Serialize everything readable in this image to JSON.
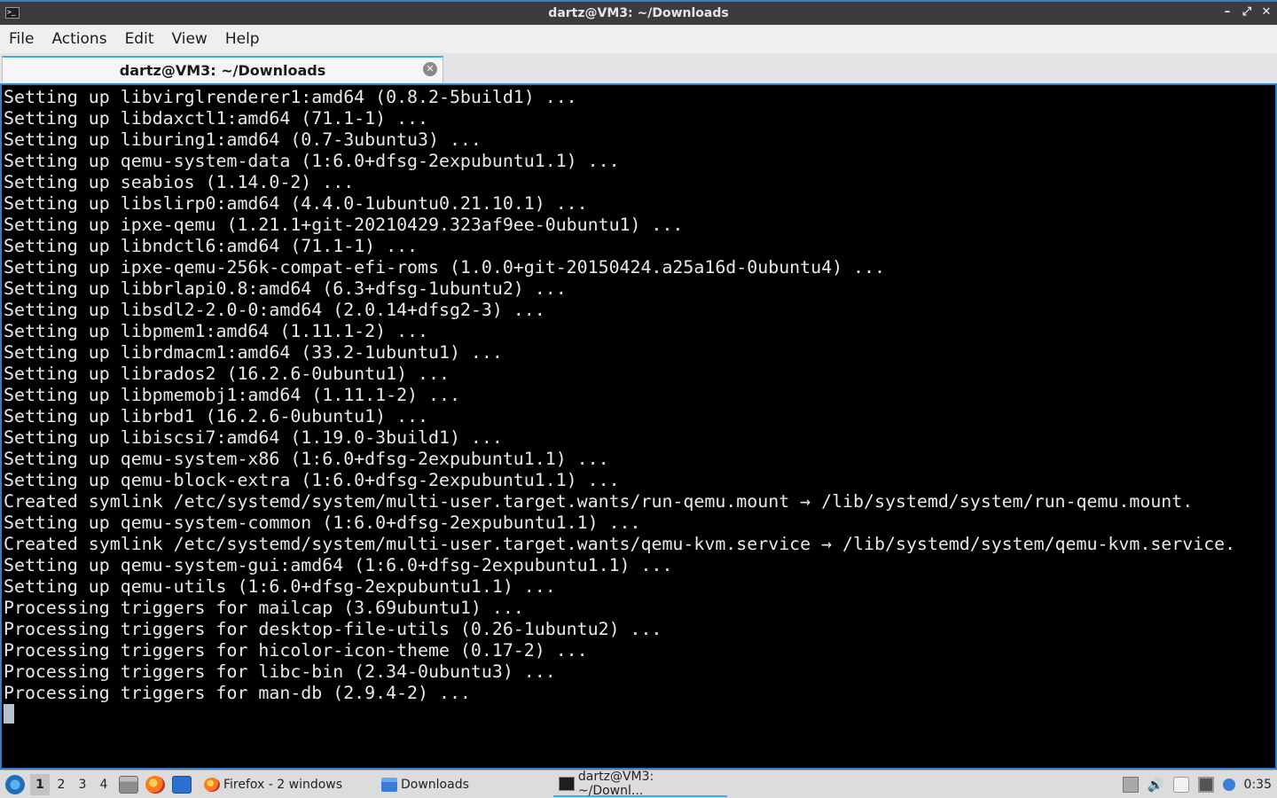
{
  "window": {
    "title": "dartz@VM3: ~/Downloads",
    "minimize_glyph": "–",
    "maximize_glyph": "⤢",
    "close_glyph": "✕"
  },
  "menu": [
    "File",
    "Actions",
    "Edit",
    "View",
    "Help"
  ],
  "tab": {
    "label": "dartz@VM3: ~/Downloads",
    "close_glyph": "✕"
  },
  "terminal": {
    "lines": [
      "Setting up libvirglrenderer1:amd64 (0.8.2-5build1) ...",
      "Setting up libdaxctl1:amd64 (71.1-1) ...",
      "Setting up liburing1:amd64 (0.7-3ubuntu3) ...",
      "Setting up qemu-system-data (1:6.0+dfsg-2expubuntu1.1) ...",
      "Setting up seabios (1.14.0-2) ...",
      "Setting up libslirp0:amd64 (4.4.0-1ubuntu0.21.10.1) ...",
      "Setting up ipxe-qemu (1.21.1+git-20210429.323af9ee-0ubuntu1) ...",
      "Setting up libndctl6:amd64 (71.1-1) ...",
      "Setting up ipxe-qemu-256k-compat-efi-roms (1.0.0+git-20150424.a25a16d-0ubuntu4) ...",
      "Setting up libbrlapi0.8:amd64 (6.3+dfsg-1ubuntu2) ...",
      "Setting up libsdl2-2.0-0:amd64 (2.0.14+dfsg2-3) ...",
      "Setting up libpmem1:amd64 (1.11.1-2) ...",
      "Setting up librdmacm1:amd64 (33.2-1ubuntu1) ...",
      "Setting up librados2 (16.2.6-0ubuntu1) ...",
      "Setting up libpmemobj1:amd64 (1.11.1-2) ...",
      "Setting up librbd1 (16.2.6-0ubuntu1) ...",
      "Setting up libiscsi7:amd64 (1.19.0-3build1) ...",
      "Setting up qemu-system-x86 (1:6.0+dfsg-2expubuntu1.1) ...",
      "Setting up qemu-block-extra (1:6.0+dfsg-2expubuntu1.1) ...",
      "Created symlink /etc/systemd/system/multi-user.target.wants/run-qemu.mount → /lib/systemd/system/run-qemu.mount.",
      "Setting up qemu-system-common (1:6.0+dfsg-2expubuntu1.1) ...",
      "Created symlink /etc/systemd/system/multi-user.target.wants/qemu-kvm.service → /lib/systemd/system/qemu-kvm.service.",
      "Setting up qemu-system-gui:amd64 (1:6.0+dfsg-2expubuntu1.1) ...",
      "Setting up qemu-utils (1:6.0+dfsg-2expubuntu1.1) ...",
      "Processing triggers for mailcap (3.69ubuntu1) ...",
      "Processing triggers for desktop-file-utils (0.26-1ubuntu2) ...",
      "Processing triggers for hicolor-icon-theme (0.17-2) ...",
      "Processing triggers for libc-bin (2.34-0ubuntu3) ...",
      "Processing triggers for man-db (2.9.4-2) ..."
    ]
  },
  "taskbar": {
    "desktops": [
      "1",
      "2",
      "3",
      "4"
    ],
    "active_desktop": "1",
    "tasks": [
      {
        "label": "Firefox - 2 windows",
        "icon": "firefox-icon"
      },
      {
        "label": "Downloads",
        "icon": "folder-icon"
      },
      {
        "label": "dartz@VM3: ~/Downl...",
        "icon": "terminal-icon"
      }
    ],
    "volume_glyph": "🔊",
    "clock": "0:35"
  }
}
